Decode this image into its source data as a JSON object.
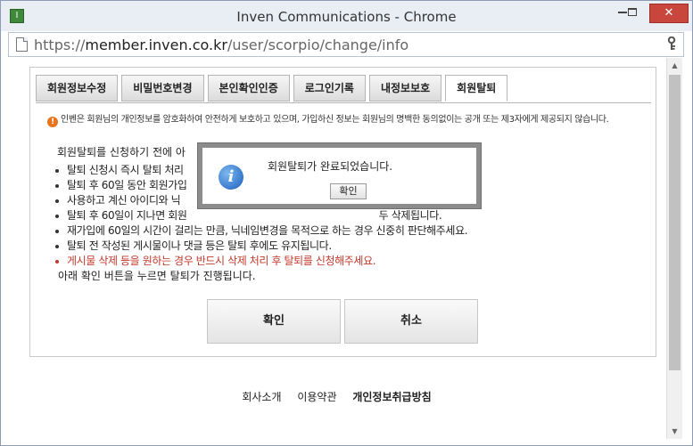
{
  "window": {
    "title": "Inven Communications - Chrome",
    "app_icon_glyph": "I",
    "minimize_label": "",
    "maximize_label": "",
    "close_label": "✕"
  },
  "address": {
    "scheme": "https://",
    "host": "member.inven.co.kr",
    "path": "/user/scorpio/change/info"
  },
  "tabs": [
    {
      "label": "회원정보수정"
    },
    {
      "label": "비밀번호변경"
    },
    {
      "label": "본인확인인증"
    },
    {
      "label": "로그인기록"
    },
    {
      "label": "내정보보호"
    },
    {
      "label": "회원탈퇴",
      "active": true
    }
  ],
  "notice": {
    "icon_glyph": "!",
    "text": "인벤은 회원님의 개인정보를 암호화하여 안전하게 보호하고 있으며, 가입하신 정보는 회원님의 명백한 동의없이는 공개 또는 제3자에게 제공되지 않습니다."
  },
  "withdraw": {
    "intro": "회원탈퇴를 신청하기 전에 아",
    "bullets": [
      "탈퇴 신청시 즉시 탈퇴 처리",
      "탈퇴 후 60일 동안 회원가입",
      "사용하고 계신 아이디와 닉",
      "탈퇴 후 60일이 지나면 회원                                                               두 삭제됩니다.",
      "재가입에 60일의 시간이 걸리는 만큼, 닉네임변경을 목적으로 하는 경우 신중히 판단해주세요.",
      "탈퇴 전 작성된 게시물이나 댓글 등은 탈퇴 후에도 유지됩니다.",
      "게시물 삭제 등을 원하는 경우 반드시 삭제 처리 후 탈퇴를 신청해주세요."
    ],
    "outro": "아래 확인 버튼을 누르면 탈퇴가 진행됩니다.",
    "confirm_label": "확인",
    "cancel_label": "취소"
  },
  "footer": {
    "links": [
      "회사소개",
      "이용약관",
      "개인정보취급방침"
    ]
  },
  "dialog": {
    "icon_glyph": "i",
    "message": "회원탈퇴가 완료되었습니다.",
    "ok_label": "확인"
  },
  "colors": {
    "warning_text": "#c0392b",
    "close_button": "#c9463d",
    "info_icon": "#1b5fbd",
    "notice_icon": "#e8731e"
  }
}
